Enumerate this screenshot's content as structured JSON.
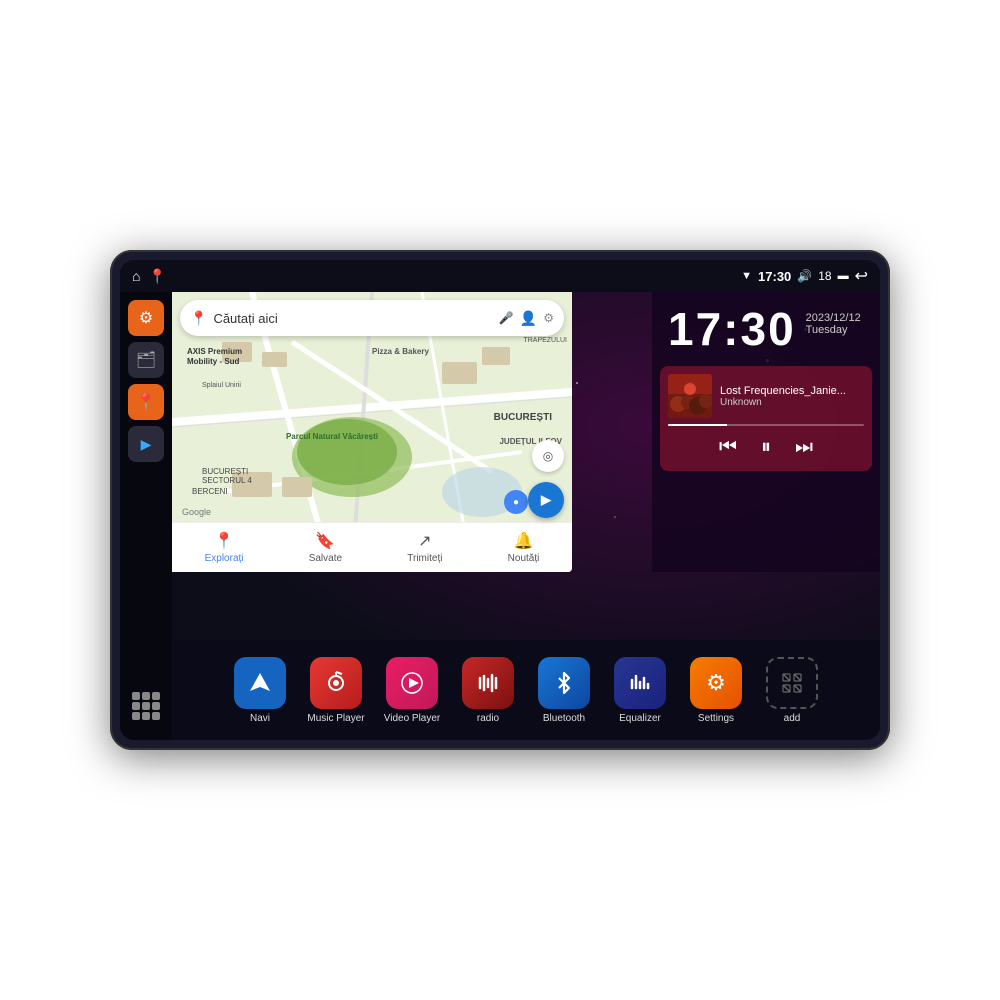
{
  "device": {
    "status_bar": {
      "wifi_icon": "▼",
      "time": "17:30",
      "volume_icon": "🔊",
      "battery_level": "18",
      "battery_icon": "▬",
      "back_icon": "↩"
    },
    "home_icon": "⌂",
    "map_icon": "📍"
  },
  "sidebar": {
    "settings_icon": "⚙",
    "file_icon": "🗂",
    "location_icon": "📍",
    "navigate_icon": "▶",
    "grid_label": "apps"
  },
  "map": {
    "search_placeholder": "Căutați aici",
    "locations": [
      "AXIS Premium Mobility - Sud",
      "Pizza & Bakery",
      "TRAPEZULUI",
      "Parcul Natural Văcărești",
      "BUCUREȘTI",
      "JUDEȚUL ILFOV",
      "BUCUREȘTI SECTORUL 4",
      "BERCENI"
    ],
    "bottom_items": [
      {
        "icon": "📍",
        "label": "Explorați",
        "active": true
      },
      {
        "icon": "🔖",
        "label": "Salvate",
        "active": false
      },
      {
        "icon": "↗",
        "label": "Trimiteți",
        "active": false
      },
      {
        "icon": "🔔",
        "label": "Noutăți",
        "active": false
      }
    ]
  },
  "clock": {
    "time": "17:30",
    "date": "2023/12/12",
    "day": "Tuesday"
  },
  "music": {
    "title": "Lost Frequencies_Janie...",
    "artist": "Unknown",
    "prev_icon": "⏮",
    "pause_icon": "⏸",
    "next_icon": "⏭",
    "progress_percent": 30
  },
  "apps": [
    {
      "id": "navi",
      "label": "Navi",
      "icon": "▶",
      "color": "blue",
      "icon_char": "➤"
    },
    {
      "id": "music-player",
      "label": "Music Player",
      "icon": "🎵",
      "color": "red"
    },
    {
      "id": "video-player",
      "label": "Video Player",
      "icon": "▶",
      "color": "pink"
    },
    {
      "id": "radio",
      "label": "radio",
      "icon": "📻",
      "color": "dark-red"
    },
    {
      "id": "bluetooth",
      "label": "Bluetooth",
      "icon": "⚡",
      "color": "bt-blue"
    },
    {
      "id": "equalizer",
      "label": "Equalizer",
      "icon": "📊",
      "color": "dark-eq"
    },
    {
      "id": "settings",
      "label": "Settings",
      "icon": "⚙",
      "color": "orange"
    },
    {
      "id": "add",
      "label": "add",
      "icon": "+",
      "color": "grid-add"
    }
  ]
}
